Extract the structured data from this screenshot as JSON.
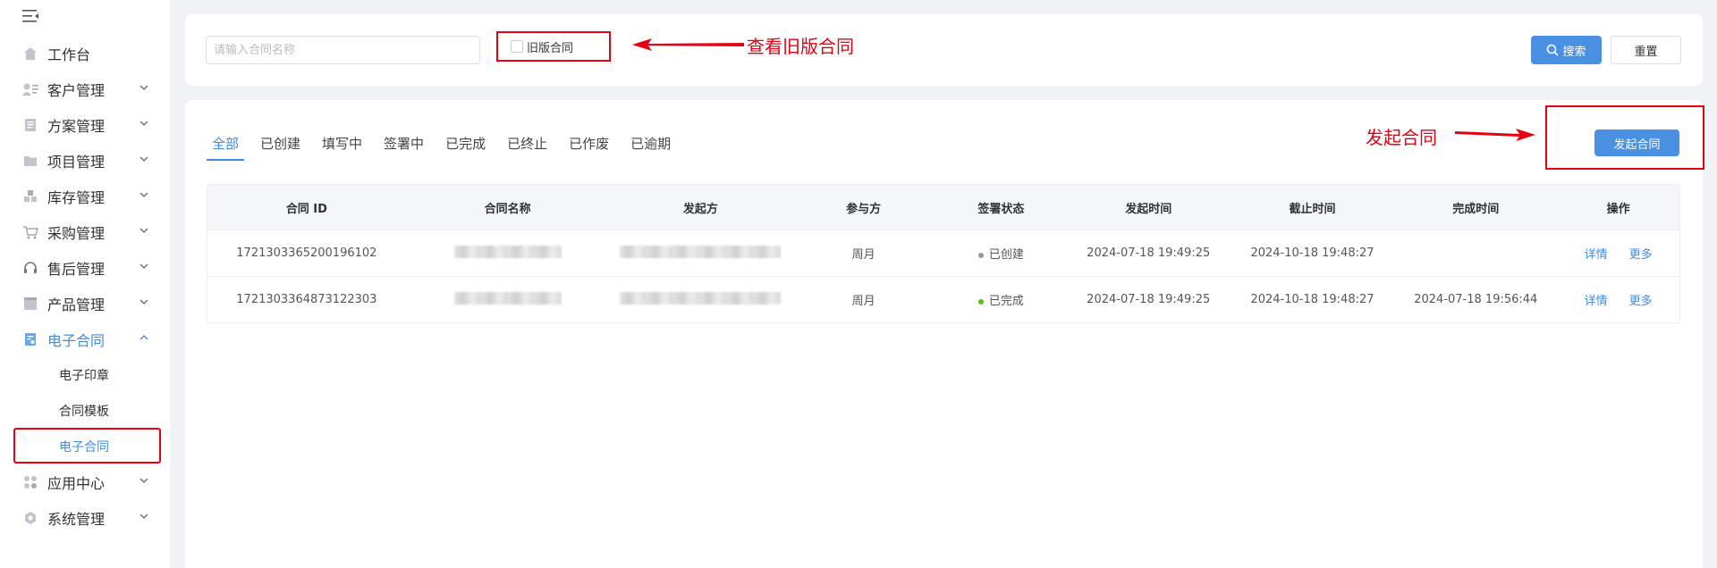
{
  "sidebar": {
    "collapse_icon": "menu-fold-icon",
    "items": [
      {
        "label": "工作台",
        "icon": "home-icon",
        "expandable": false
      },
      {
        "label": "客户管理",
        "icon": "customer-icon",
        "expandable": true
      },
      {
        "label": "方案管理",
        "icon": "document-icon",
        "expandable": true
      },
      {
        "label": "项目管理",
        "icon": "folder-icon",
        "expandable": true
      },
      {
        "label": "库存管理",
        "icon": "inventory-icon",
        "expandable": true
      },
      {
        "label": "采购管理",
        "icon": "cart-icon",
        "expandable": true
      },
      {
        "label": "售后管理",
        "icon": "headset-icon",
        "expandable": true
      },
      {
        "label": "产品管理",
        "icon": "box-icon",
        "expandable": true
      },
      {
        "label": "电子合同",
        "icon": "contract-icon",
        "expandable": true,
        "expanded": true,
        "active": true
      },
      {
        "label": "应用中心",
        "icon": "apps-icon",
        "expandable": true
      },
      {
        "label": "系统管理",
        "icon": "settings-icon",
        "expandable": true
      }
    ],
    "sub_items": [
      {
        "label": "电子印章"
      },
      {
        "label": "合同模板"
      },
      {
        "label": "电子合同",
        "current": true
      }
    ]
  },
  "search": {
    "placeholder": "请输入合同名称",
    "value": "",
    "old_version_label": "旧版合同",
    "old_version_checked": false,
    "search_label": "搜索",
    "reset_label": "重置"
  },
  "annotations": {
    "old_version_note": "查看旧版合同",
    "launch_note": "发起合同"
  },
  "tabs": [
    {
      "label": "全部",
      "active": true
    },
    {
      "label": "已创建"
    },
    {
      "label": "填写中"
    },
    {
      "label": "签署中"
    },
    {
      "label": "已完成"
    },
    {
      "label": "已终止"
    },
    {
      "label": "已作废"
    },
    {
      "label": "已逾期"
    }
  ],
  "launch_button": "发起合同",
  "table": {
    "columns": [
      "合同 ID",
      "合同名称",
      "发起方",
      "参与方",
      "签署状态",
      "发起时间",
      "截止时间",
      "完成时间",
      "操作"
    ],
    "rows": [
      {
        "id": "1721303365200196102",
        "participant": "周月",
        "status": "已创建",
        "status_color": "#999999",
        "start_time": "2024-07-18 19:49:25",
        "deadline": "2024-10-18 19:48:27",
        "finish_time": "",
        "op_detail": "详情",
        "op_more": "更多"
      },
      {
        "id": "1721303364873122303",
        "participant": "周月",
        "status": "已完成",
        "status_color": "#52c41a",
        "start_time": "2024-07-18 19:49:25",
        "deadline": "2024-10-18 19:48:27",
        "finish_time": "2024-07-18 19:56:44",
        "op_detail": "详情",
        "op_more": "更多"
      }
    ]
  },
  "colors": {
    "primary": "#4a90e2",
    "annotation_red": "#e60012",
    "active_menu": "#3c8ce7"
  }
}
